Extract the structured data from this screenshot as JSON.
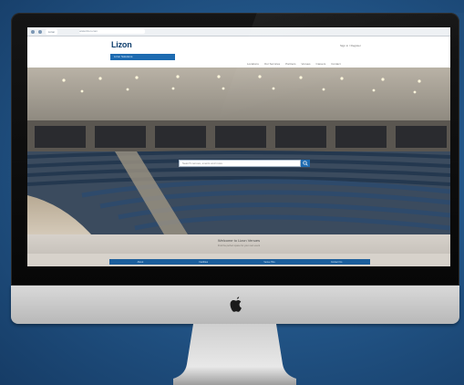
{
  "browser": {
    "tab_label": "Lizon",
    "url_text": "www.lizon.com"
  },
  "site": {
    "logo": "Lizon",
    "header_strip": "Lizon Solutions",
    "account_link": "Sign in / Register",
    "nav": [
      "Locations",
      "Our Services",
      "Partners",
      "Venues",
      "Careers",
      "Contact"
    ]
  },
  "hero": {
    "search_placeholder": "Search venues, events and more"
  },
  "welcome": {
    "title": "Welcome to Lizon Venues",
    "subtitle": "Find the perfect space for your next event"
  },
  "footer": {
    "links": [
      "About",
      "Facilities",
      "Venue Hire",
      "Contact Us"
    ]
  },
  "colors": {
    "background": "#23578a",
    "accent": "#1e6bb1",
    "seats": "#2e4a6b",
    "logo": "#0f3f6e"
  }
}
